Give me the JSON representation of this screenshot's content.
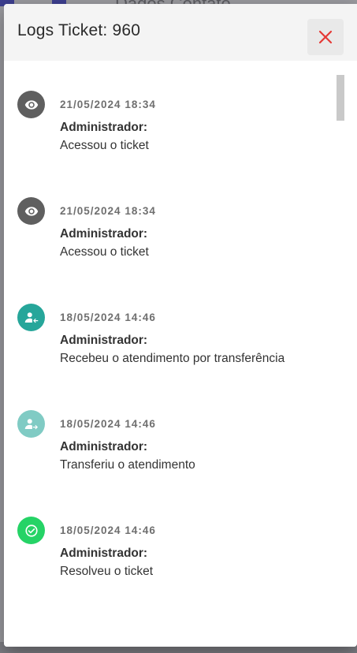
{
  "background": {
    "partial_text": "Dados Contato"
  },
  "dialog": {
    "title": "Logs Ticket: 960",
    "close_icon": "close-icon",
    "close_color": "#e53935"
  },
  "logs": [
    {
      "icon": "eye-icon",
      "icon_bg": "#5f5f5f",
      "timestamp": "21/05/2024 18:34",
      "user": "Administrador:",
      "action": "Acessou o ticket"
    },
    {
      "icon": "eye-icon",
      "icon_bg": "#5f5f5f",
      "timestamp": "21/05/2024 18:34",
      "user": "Administrador:",
      "action": "Acessou o ticket"
    },
    {
      "icon": "person-received-icon",
      "icon_bg": "#26a69a",
      "timestamp": "18/05/2024 14:46",
      "user": "Administrador:",
      "action": "Recebeu o atendimento por transferência"
    },
    {
      "icon": "person-transfer-icon",
      "icon_bg": "#80cbc4",
      "timestamp": "18/05/2024 14:46",
      "user": "Administrador:",
      "action": "Transferiu o atendimento"
    },
    {
      "icon": "check-circle-icon",
      "icon_bg": "#25d366",
      "timestamp": "18/05/2024 14:46",
      "user": "Administrador:",
      "action": "Resolveu o ticket"
    }
  ]
}
